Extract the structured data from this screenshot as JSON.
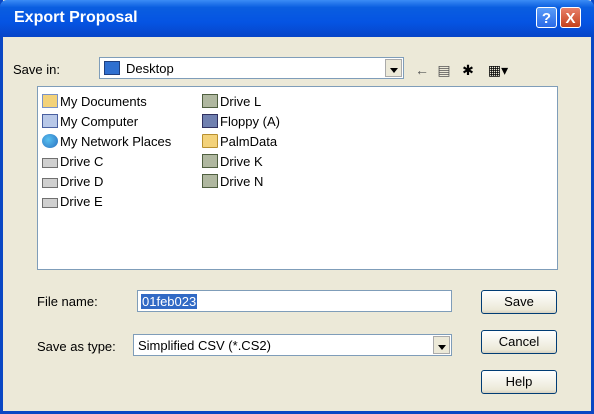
{
  "window": {
    "title": "Export Proposal"
  },
  "title_buttons": {
    "help": "?",
    "close": "X"
  },
  "toolbar": {
    "save_in_label": "Save in:",
    "save_in_value": "Desktop",
    "back_icon": "back-arrow-icon",
    "up_icon": "up-folder-icon",
    "new_folder_icon": "new-folder-icon",
    "views_icon": "views-menu-icon"
  },
  "files": [
    {
      "name": "My Documents",
      "icon": "my-documents-icon"
    },
    {
      "name": "My Computer",
      "icon": "my-computer-icon"
    },
    {
      "name": "My Network Places",
      "icon": "network-places-icon"
    },
    {
      "name": "Drive C",
      "icon": "drive-icon"
    },
    {
      "name": "Drive D",
      "icon": "drive-icon"
    },
    {
      "name": "Drive E",
      "icon": "drive-icon"
    },
    {
      "name": "Drive L",
      "icon": "network-drive-icon"
    },
    {
      "name": "Floppy (A)",
      "icon": "floppy-icon"
    },
    {
      "name": "PalmData",
      "icon": "folder-icon"
    },
    {
      "name": "Drive K",
      "icon": "network-drive-icon"
    },
    {
      "name": "Drive N",
      "icon": "network-drive-icon"
    }
  ],
  "form": {
    "file_name_label": "File name:",
    "file_name_value": "01feb023",
    "save_type_label": "Save as type:",
    "save_type_value": "Simplified CSV (*.CS2)"
  },
  "buttons": {
    "save": "Save",
    "cancel": "Cancel",
    "help": "Help"
  },
  "colors": {
    "titlebar": "#0554e3",
    "dialog": "#ece9d8",
    "selection": "#316ac5"
  }
}
